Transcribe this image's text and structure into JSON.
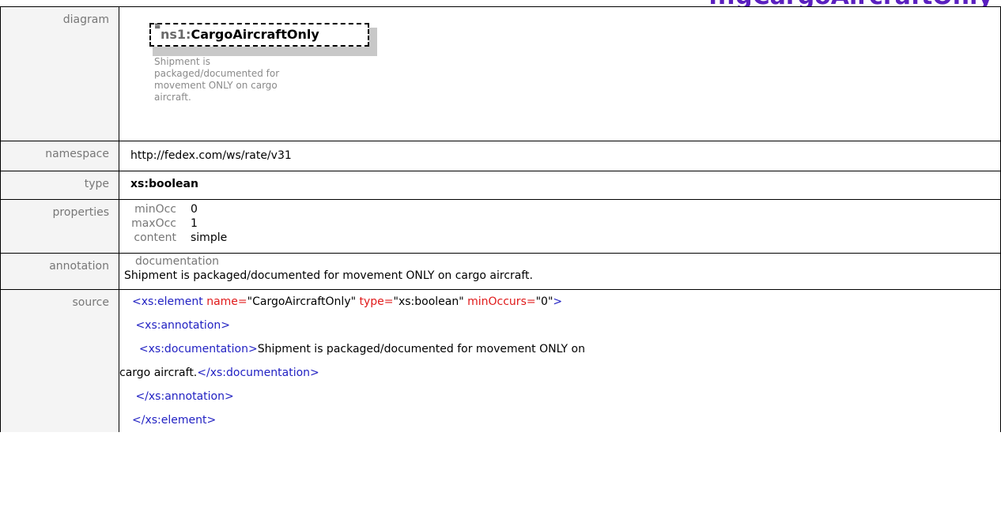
{
  "header_fragment": "...gCargoAircraftOnly",
  "labels": {
    "diagram": "diagram",
    "namespace": "namespace",
    "type": "type",
    "properties": "properties",
    "annotation": "annotation",
    "source": "source"
  },
  "diagram": {
    "prefix": "ns1:",
    "name": "CargoAircraftOnly",
    "doc_lines": [
      "Shipment is",
      "packaged/documented for",
      "movement ONLY on cargo",
      "aircraft."
    ]
  },
  "namespace": "http://fedex.com/ws/rate/v31",
  "type": "xs:boolean",
  "properties": [
    {
      "key": "minOcc",
      "value": "0"
    },
    {
      "key": "maxOcc",
      "value": "1"
    },
    {
      "key": "content",
      "value": "simple"
    }
  ],
  "annotation": {
    "heading": "documentation",
    "text": "Shipment is packaged/documented for movement ONLY on cargo aircraft."
  },
  "source": {
    "l1_open": "<xs:element",
    "l1_a1": " name=",
    "l1_v1": "\"CargoAircraftOnly\"",
    "l1_a2": " type=",
    "l1_v2": "\"xs:boolean\"",
    "l1_a3": " minOccurs=",
    "l1_v3": "\"0\"",
    "l1_close": ">",
    "l2": " <xs:annotation>",
    "l3_open": "  <xs:documentation>",
    "l3_text": "Shipment is packaged/documented for movement ONLY on",
    "l4_text": "cargo aircraft.",
    "l4_close": "</xs:documentation>",
    "l5": " </xs:annotation>",
    "l6": "</xs:element>"
  }
}
